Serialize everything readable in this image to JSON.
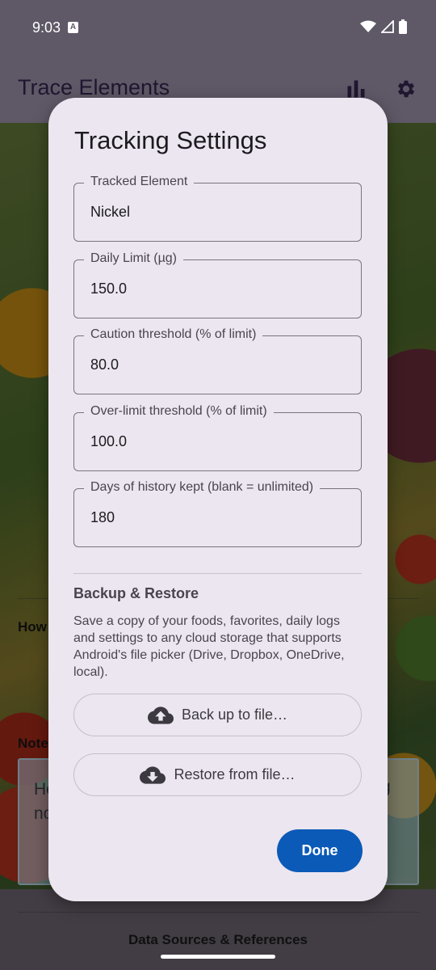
{
  "status_bar": {
    "time": "9:03"
  },
  "app": {
    "title": "Trace Elements",
    "how_label": "How",
    "notes_label": "Note",
    "notes_text_left_line1": "He",
    "notes_text_left_line2": "no",
    "notes_text_right": "g",
    "footer_link": "Data Sources & References"
  },
  "dialog": {
    "title": "Tracking Settings",
    "fields": [
      {
        "label": "Tracked Element",
        "value": "Nickel"
      },
      {
        "label": "Daily Limit (µg)",
        "value": "150.0"
      },
      {
        "label": "Caution threshold (% of limit)",
        "value": "80.0"
      },
      {
        "label": "Over-limit threshold (% of limit)",
        "value": "100.0"
      },
      {
        "label": "Days of history kept (blank = unlimited)",
        "value": "180"
      }
    ],
    "backup": {
      "title": "Backup & Restore",
      "description": "Save a copy of your foods, favorites, daily logs and settings to any cloud storage that supports Android's file picker (Drive, Dropbox, OneDrive, local).",
      "backup_label": "Back up to file…",
      "restore_label": "Restore from file…"
    },
    "done_label": "Done"
  },
  "colors": {
    "primary": "#0b5ab7",
    "dialog_surface": "#ece6f0",
    "app_bar": "#5f5867"
  },
  "icons": [
    "stats-icon",
    "settings-icon",
    "cloud-upload-icon",
    "cloud-download-icon",
    "wifi-icon",
    "signal-icon",
    "battery-icon"
  ]
}
